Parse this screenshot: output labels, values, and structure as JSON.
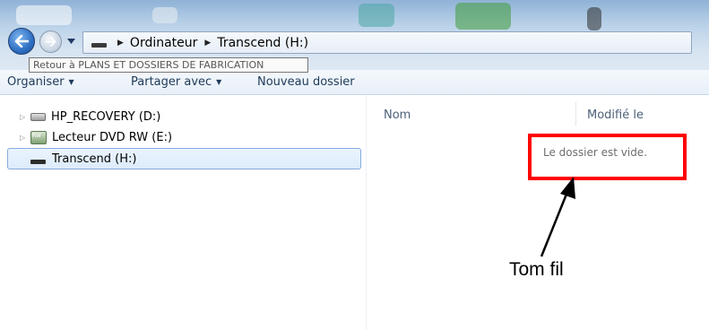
{
  "address_bar": {
    "breadcrumbs": [
      "Ordinateur",
      "Transcend (H:)"
    ],
    "drive_icon": "usb-drive-icon"
  },
  "navigation": {
    "back_icon": "back-arrow-icon",
    "forward_icon": "forward-arrow-icon",
    "recent_icon": "chevron-down-icon"
  },
  "tooltip": {
    "text": "Retour à PLANS ET DOSSIERS DE FABRICATION"
  },
  "toolbar": {
    "organize_label": "Organiser",
    "share_label": "Partager avec",
    "new_folder_label": "Nouveau dossier"
  },
  "sidebar": {
    "items": [
      {
        "label": "HP_RECOVERY (D:)",
        "icon": "hard-drive-icon",
        "expandable": true
      },
      {
        "label": "Lecteur DVD RW (E:)",
        "icon": "dvd-drive-icon",
        "expandable": true
      },
      {
        "label": "Transcend (H:)",
        "icon": "usb-drive-icon",
        "selected": true
      }
    ]
  },
  "content": {
    "columns": [
      "Nom",
      "Modifié le"
    ],
    "empty_message": "Le dossier est vide."
  },
  "annotation": {
    "label": "Tom fil",
    "box_color": "#ff0000"
  }
}
